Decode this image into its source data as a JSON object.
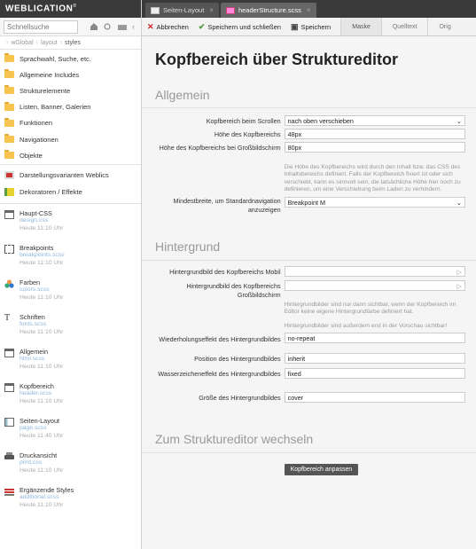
{
  "logo": {
    "text": "Weblication",
    "mark": "®"
  },
  "search": {
    "placeholder": "Schnellsuche"
  },
  "breadcrumb": {
    "items": [
      "wGlobal",
      "layout",
      "styles"
    ]
  },
  "folders": [
    "Sprachwahl, Suche, etc.",
    "Allgemeine Includes",
    "Strukturelemente",
    "Listen, Banner, Galerien",
    "Funktionen",
    "Navigationen",
    "Objekte"
  ],
  "groups": [
    "Darstellungsvarianten Weblics",
    "Dekoratoren / Effekte"
  ],
  "styles": [
    {
      "title": "Haupt-CSS",
      "file": "design.css",
      "date": "Heute 11:10 Uhr",
      "icon": "css-file-icon"
    },
    {
      "title": "Breakpoints",
      "file": "breakpoints.scss",
      "date": "Heute 11:10 Uhr",
      "icon": "breakpoints-icon"
    },
    {
      "title": "Farben",
      "file": "colors.scss",
      "date": "Heute 11:10 Uhr",
      "icon": "colors-icon"
    },
    {
      "title": "Schriften",
      "file": "fonts.scss",
      "date": "Heute 11:10 Uhr",
      "icon": "font-icon"
    },
    {
      "title": "Allgemein",
      "file": "html.scss",
      "date": "Heute 11:10 Uhr",
      "icon": "general-icon"
    },
    {
      "title": "Kopfbereich",
      "file": "header.scss",
      "date": "Heute 11:10 Uhr",
      "icon": "header-icon"
    },
    {
      "title": "Seiten-Layout",
      "file": "page.scss",
      "date": "Heute 11:40 Uhr",
      "icon": "page-layout-icon"
    },
    {
      "title": "Druckansicht",
      "file": "print.css",
      "date": "Heute 11:10 Uhr",
      "icon": "printer-icon"
    },
    {
      "title": "Ergänzende Styles",
      "file": "additional.scss",
      "date": "Heute 11:10 Uhr",
      "icon": "additional-styles-icon"
    }
  ],
  "tabs": [
    {
      "label": "Seiten-Layout"
    },
    {
      "label": "headerStructure.scss"
    }
  ],
  "toolbar": {
    "cancel": "Abbrechen",
    "save_close": "Speichern und schließen",
    "save": "Speichern",
    "mask": "Maske",
    "source": "Quelltext",
    "orig": "Orig"
  },
  "page": {
    "title": "Kopfbereich über Strukturedit­or"
  },
  "sections": {
    "general": "Allgemein",
    "background": "Hintergrund",
    "editor": "Zum Strukturedit­or wechseln"
  },
  "fields": {
    "scroll": {
      "label": "Kopfbereich beim Scrollen",
      "value": "nach oben verschieben"
    },
    "height": {
      "label": "Höhe des Kopfbereichs",
      "value": "48px"
    },
    "height_large": {
      "label": "Höhe des Kopfbereichs bei Großbildschirm",
      "value": "80px"
    },
    "height_hint": "Die Höhe des Kopfbereichs wird durch den Inhalt bzw. das CSS des Inhaltsbereichs definiert. Falls der Kopfbereich fixiert ist oder sich verschiebt, kann es sinnvoll sein, die tatsächliche Höhe hier noch zu definieren, um eine Verschiebung beim Laden zu verhindern.",
    "min_width": {
      "label": "Mindestbreite, um Standardnavigation anzuzeigen",
      "value": "Breakpoint M"
    },
    "bg_mobile": {
      "label": "Hintergrundbild des Kopfbereichs Mobil",
      "value": ""
    },
    "bg_large": {
      "label": "Hintergrundbild des Kopfbereichs Großbildschirm",
      "value": ""
    },
    "bg_hint1": "Hintergrundbilder sind nur dann sichtbar, wenn der Kopfbereich im Editor keine eigene Hintergrundfarbe definiert hat.",
    "bg_hint2": "Hintergrundbilder sind außerdem erst in der Vorschau sichtbar!",
    "repeat": {
      "label": "Wiederholungseffekt des Hintergrundbildes",
      "value": "no-repeat"
    },
    "position": {
      "label": "Position des Hintergrundbildes",
      "value": "inherit"
    },
    "attach": {
      "label": "Wasserzeicheneffekt des Hintergrundbildes",
      "value": "fixed"
    },
    "size": {
      "label": "Größe des Hintergrundbildes",
      "value": "cover"
    }
  },
  "editor_button": "Kopfbereich anpassen"
}
